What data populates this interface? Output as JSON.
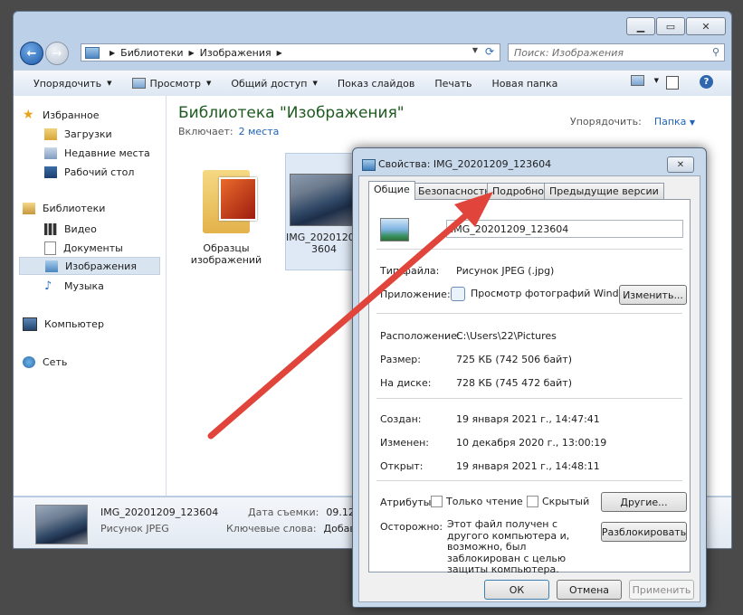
{
  "explorer": {
    "address": {
      "part1": "Библиотеки",
      "part2": "Изображения"
    },
    "search_placeholder": "Поиск: Изображения",
    "toolbar": {
      "organize": "Упорядочить",
      "preview": "Просмотр",
      "share": "Общий доступ",
      "slideshow": "Показ слайдов",
      "print": "Печать",
      "new_folder": "Новая папка"
    },
    "sidebar": {
      "favorites": "Избранное",
      "downloads": "Загрузки",
      "recent": "Недавние места",
      "desktop": "Рабочий стол",
      "libraries": "Библиотеки",
      "video": "Видео",
      "documents": "Документы",
      "images": "Изображения",
      "music": "Музыка",
      "computer": "Компьютер",
      "network": "Сеть"
    },
    "main": {
      "title": "Библиотека \"Изображения\"",
      "includes_label": "Включает:",
      "includes_value": "2 места",
      "arrange_label": "Упорядочить:",
      "arrange_value": "Папка",
      "tile1_line1": "Образцы",
      "tile1_line2": "изображений",
      "tile2_line1": "IMG_20201209_12",
      "tile2_line2": "3604"
    },
    "details": {
      "name": "IMG_20201209_123604",
      "type": "Рисунок JPEG",
      "date_label": "Дата съемки:",
      "date_value": "09.12.20",
      "keywords_label": "Ключевые слова:",
      "keywords_value": "Добавь"
    }
  },
  "dialog": {
    "title": "Свойства: IMG_20201209_123604",
    "tabs": {
      "general": "Общие",
      "security": "Безопасность",
      "details": "Подробно",
      "previous": "Предыдущие версии"
    },
    "file_name": "IMG_20201209_123604",
    "type_label": "Тип файла:",
    "type_value": "Рисунок JPEG (.jpg)",
    "app_label": "Приложение:",
    "app_value": "Просмотр фотографий Windows",
    "change_button": "Изменить...",
    "location_label": "Расположение:",
    "location_value": "C:\\Users\\22\\Pictures",
    "size_label": "Размер:",
    "size_value": "725 КБ (742 506 байт)",
    "disk_label": "На диске:",
    "disk_value": "728 КБ (745 472 байт)",
    "created_label": "Создан:",
    "created_value": "19 января 2021 г., 14:47:41",
    "modified_label": "Изменен:",
    "modified_value": "10 декабря 2020 г., 13:00:19",
    "opened_label": "Открыт:",
    "opened_value": "19 января 2021 г., 14:48:11",
    "attributes_label": "Атрибуты:",
    "readonly_label": "Только чтение",
    "hidden_label": "Скрытый",
    "other_button": "Другие...",
    "caution_label": "Осторожно:",
    "caution_text": "Этот файл получен с другого компьютера и, возможно, был заблокирован с целью защиты компьютера.",
    "unblock_button": "Разблокировать",
    "ok_button": "ОК",
    "cancel_button": "Отмена",
    "apply_button": "Применить"
  },
  "colors": {
    "annotation_arrow": "#e0443a",
    "library_title": "#1e5a20",
    "link": "#1f64b8"
  }
}
